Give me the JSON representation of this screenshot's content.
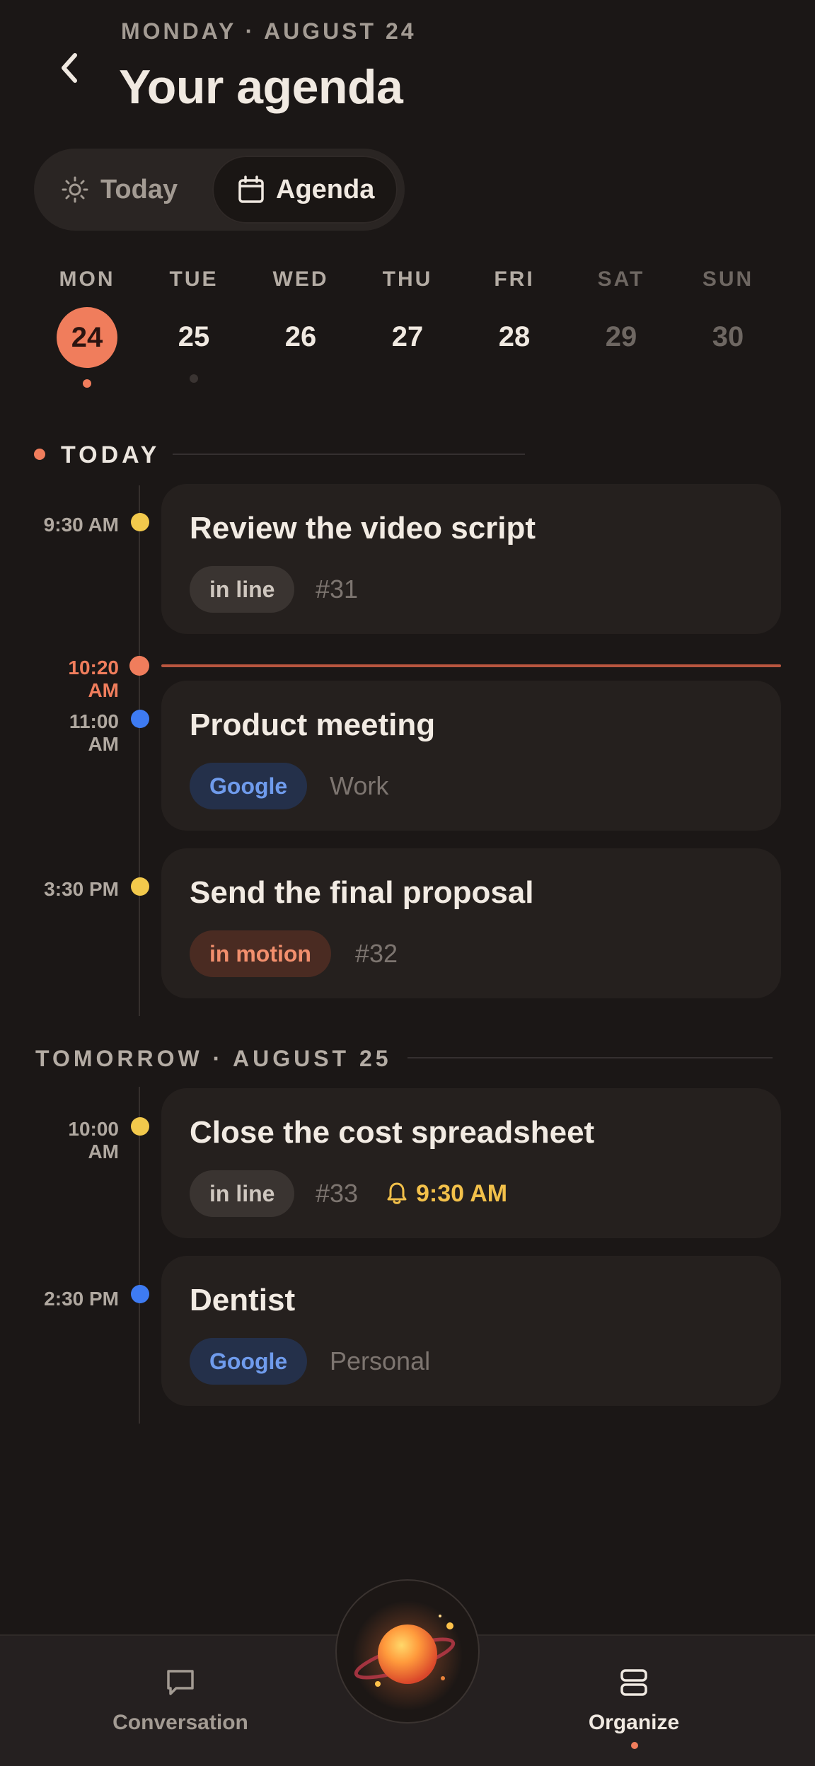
{
  "header": {
    "date_line": "MONDAY · AUGUST 24",
    "title": "Your agenda"
  },
  "segmented": {
    "today_label": "Today",
    "agenda_label": "Agenda",
    "selected": "Agenda"
  },
  "week": [
    {
      "label": "MON",
      "num": "24",
      "selected": true,
      "has_events": true
    },
    {
      "label": "TUE",
      "num": "25",
      "selected": false,
      "has_events": true
    },
    {
      "label": "WED",
      "num": "26",
      "selected": false
    },
    {
      "label": "THU",
      "num": "27",
      "selected": false
    },
    {
      "label": "FRI",
      "num": "28",
      "selected": false
    },
    {
      "label": "SAT",
      "num": "29",
      "weekend": true
    },
    {
      "label": "SUN",
      "num": "30",
      "weekend": true
    }
  ],
  "today_section": {
    "label": "TODAY",
    "now_time": "10:20 AM",
    "events": [
      {
        "time": "9:30 AM",
        "title": "Review the video script",
        "chip": "in line",
        "meta": "#31",
        "dot_color": "#f2c94c"
      },
      {
        "time": "11:00 AM",
        "title": "Product meeting",
        "chip": "Google",
        "meta": "Work",
        "dot_color": "#3e7bf2"
      },
      {
        "time": "3:30 PM",
        "title": "Send the final proposal",
        "chip": "in motion",
        "meta": "#32",
        "dot_color": "#f2c94c"
      }
    ]
  },
  "tomorrow_section": {
    "label": "TOMORROW · AUGUST 25",
    "events": [
      {
        "time": "10:00 AM",
        "title": "Close the cost spreadsheet",
        "chip": "in line",
        "meta": "#33",
        "alarm": "9:30 AM",
        "dot_color": "#f2c94c"
      },
      {
        "time": "2:30 PM",
        "title": "Dentist",
        "chip": "Google",
        "meta": "Personal",
        "dot_color": "#3e7bf2"
      }
    ]
  },
  "nav": {
    "conversation": "Conversation",
    "organize": "Organize",
    "active": "Organize"
  },
  "colors": {
    "accent": "#f07d5c",
    "background": "#1b1716",
    "card": "#25201e",
    "yellow": "#f2c94c",
    "blue": "#3e7bf2"
  }
}
